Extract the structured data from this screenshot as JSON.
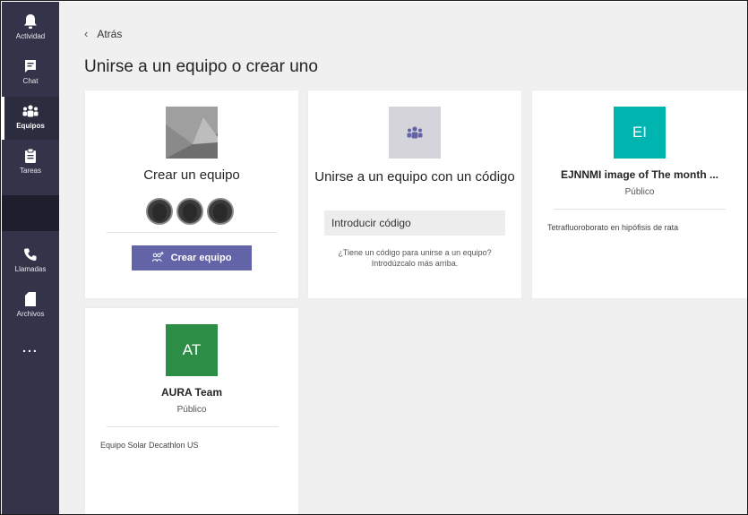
{
  "rail": {
    "items": [
      {
        "label": "Actividad",
        "icon": "bell-icon"
      },
      {
        "label": "Chat",
        "icon": "chat-icon"
      },
      {
        "label": "Equipos",
        "icon": "teams-icon"
      },
      {
        "label": "Tareas",
        "icon": "tasks-icon"
      },
      {
        "label": "Llamadas",
        "icon": "phone-icon"
      },
      {
        "label": "Archivos",
        "icon": "file-icon"
      }
    ],
    "more": "..."
  },
  "main": {
    "back_label": "Atrás",
    "title": "Unirse a un equipo o crear uno"
  },
  "create_card": {
    "heading": "Crear un equipo",
    "button_label": "Crear equipo"
  },
  "join_card": {
    "heading": "Unirse a un equipo con un código",
    "input_placeholder": "Introducir código",
    "help_text": "¿Tiene un código para unirse a un equipo? Introdúzcalo más arriba."
  },
  "teams": [
    {
      "initials": "EI",
      "name": "EJNNMI image of The month ...",
      "visibility": "Público",
      "description": "Tetrafluoroborato en hipófisis de rata",
      "color": "#00b4b0"
    },
    {
      "initials": "AT",
      "name": "AURA Team",
      "visibility": "Público",
      "description": "Equipo Solar Decathlon US",
      "color": "#2c8e46"
    }
  ],
  "colors": {
    "rail": "#33344a",
    "accent": "#6264a7",
    "background": "#f0f0f0"
  }
}
